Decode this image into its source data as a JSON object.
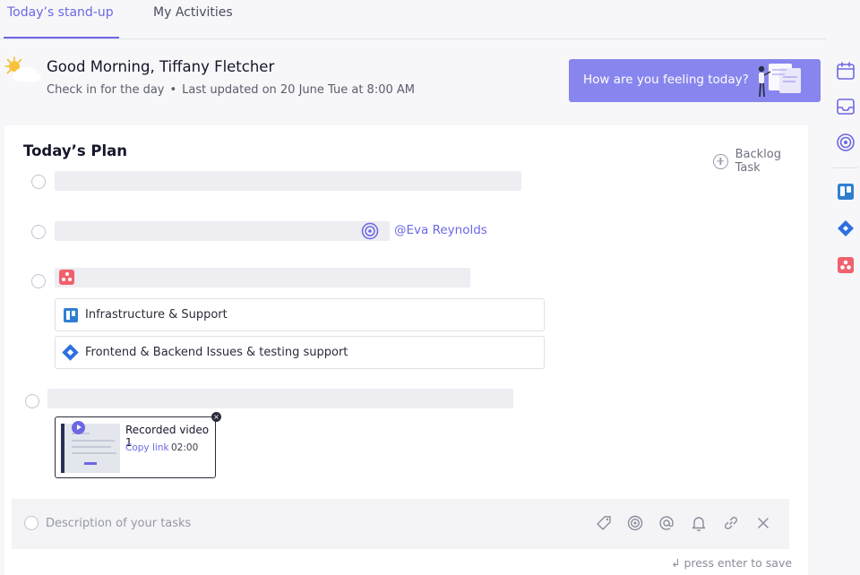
{
  "tabs": {
    "active": "Today’s stand-up",
    "inactive": "My Activities"
  },
  "header": {
    "greeting": "Good Morning, Tiffany Fletcher",
    "checkin": "Check in for the day",
    "separator": "•",
    "last_updated": "Last updated on 20 June Tue at 8:00 AM",
    "feeling_button": "How are you feeling today?"
  },
  "plan": {
    "title": "Today’s Plan",
    "backlog_label": "Backlog Task",
    "mention": "@Eva Reynolds",
    "linked_items": [
      {
        "label": "Infrastructure & Support",
        "icon": "trello-icon"
      },
      {
        "label": "Frontend & Backend Issues & testing support",
        "icon": "jira-icon"
      }
    ],
    "video": {
      "title": "Recorded video 1",
      "copy_link": "Copy link",
      "duration": "02:00",
      "close": "×"
    }
  },
  "composer": {
    "placeholder": "Description of your tasks",
    "hint": "↲ press enter to save"
  },
  "colors": {
    "accent": "#6c67e4",
    "feeling_bg": "#8886ee",
    "asana": "#f0606d",
    "trello": "#2f7fd1",
    "jira": "#2d6fe0"
  }
}
